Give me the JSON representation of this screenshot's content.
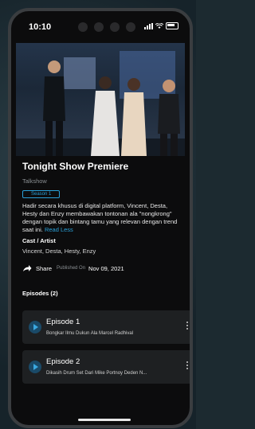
{
  "status": {
    "time": "10:10"
  },
  "show": {
    "title": "Tonight Show Premiere",
    "genre": "Talkshow",
    "season_badge": "Season 1",
    "description": "Hadir secara khusus di digital platform, Vincent, Desta, Hesty dan Enzy membawakan tontonan ala \"nongkrong\" dengan topik dan bintang tamu yang relevan dengan trend saat ini.",
    "read_less": "Read Less",
    "cast_heading": "Cast / Artist",
    "cast": "Vincent, Desta, Hesty, Enzy",
    "share_label": "Share",
    "published_label": "Published On",
    "published_date": "Nov 09, 2021"
  },
  "episodes": {
    "heading": "Episodes (2)",
    "items": [
      {
        "title": "Episode 1",
        "subtitle": "Bongkar Ilmu Dukun Ala Marcel Radhival"
      },
      {
        "title": "Episode 2",
        "subtitle": "Dikasih Drum Set Dari Mike Portnoy Deden N..."
      }
    ]
  },
  "colors": {
    "accent": "#2aa0d8",
    "background": "#0c0c0d",
    "card": "#1e2022"
  }
}
